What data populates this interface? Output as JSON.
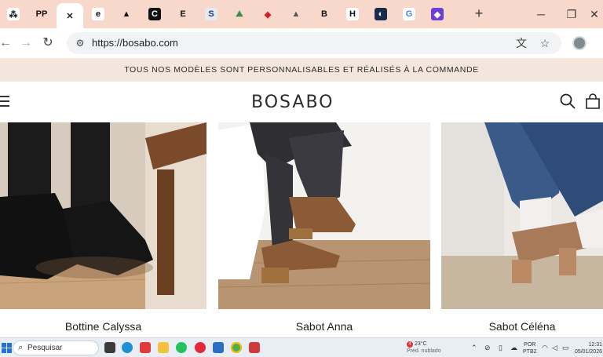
{
  "browser": {
    "tabs": [
      {
        "icon": "asterisk-icon",
        "glyph": "⁂",
        "bg": "#ffffff",
        "fg": "#111111"
      },
      {
        "icon": "pp-icon",
        "glyph": "PP",
        "bg": "transparent",
        "fg": "#111111"
      },
      {
        "icon": "close-icon",
        "glyph": "✕",
        "bg": "transparent",
        "fg": "#222222",
        "active": true
      },
      {
        "icon": "e-icon",
        "glyph": "e",
        "bg": "#ffffff",
        "fg": "#111111"
      },
      {
        "icon": "adidas-icon",
        "glyph": "▲",
        "bg": "transparent",
        "fg": "#111111"
      },
      {
        "icon": "c-icon",
        "glyph": "C",
        "bg": "#111111",
        "fg": "#ffffff"
      },
      {
        "icon": "e-italic-icon",
        "glyph": "E",
        "bg": "transparent",
        "fg": "#111111"
      },
      {
        "icon": "s-icon",
        "glyph": "S",
        "bg": "#e6e9f0",
        "fg": "#1f3b73"
      },
      {
        "icon": "landscape-icon",
        "glyph": "⛰",
        "bg": "transparent",
        "fg": "#3b8f4a"
      },
      {
        "icon": "lips-icon",
        "glyph": "◆",
        "bg": "transparent",
        "fg": "#d0202a"
      },
      {
        "icon": "triangle-icon",
        "glyph": "▲",
        "bg": "transparent",
        "fg": "#555555"
      },
      {
        "icon": "b-icon",
        "glyph": "B",
        "bg": "transparent",
        "fg": "#111111"
      },
      {
        "icon": "h-icon",
        "glyph": "H",
        "bg": "#ffffff",
        "fg": "#111111"
      },
      {
        "icon": "swirl-icon",
        "glyph": "◐",
        "bg": "#1a2b4c",
        "fg": "#ffffff"
      },
      {
        "icon": "google-icon",
        "glyph": "G",
        "bg": "#ffffff",
        "fg": "#4285f4"
      },
      {
        "icon": "purple-icon",
        "glyph": "◆",
        "bg": "#6b3fd6",
        "fg": "#ffffff"
      }
    ],
    "new_tab": "+",
    "url": "https://bosabo.com"
  },
  "site": {
    "banner": "TOUS NOS MODÈLES SONT PERSONNALISABLES ET RÉALISÉS À LA COMMANDE",
    "logo": "BOSABO",
    "products": [
      {
        "name": "Bottine Calyssa"
      },
      {
        "name": "Sabot Anna"
      },
      {
        "name": "Sabot Céléna"
      }
    ]
  },
  "taskbar": {
    "search": "Pesquisar",
    "weather_badge": "4",
    "weather_temp": "23°C",
    "weather_desc": "Pred. nublado",
    "lang1": "POR",
    "lang2": "PTB2",
    "time": "12:31",
    "date": "05/01/2026"
  }
}
